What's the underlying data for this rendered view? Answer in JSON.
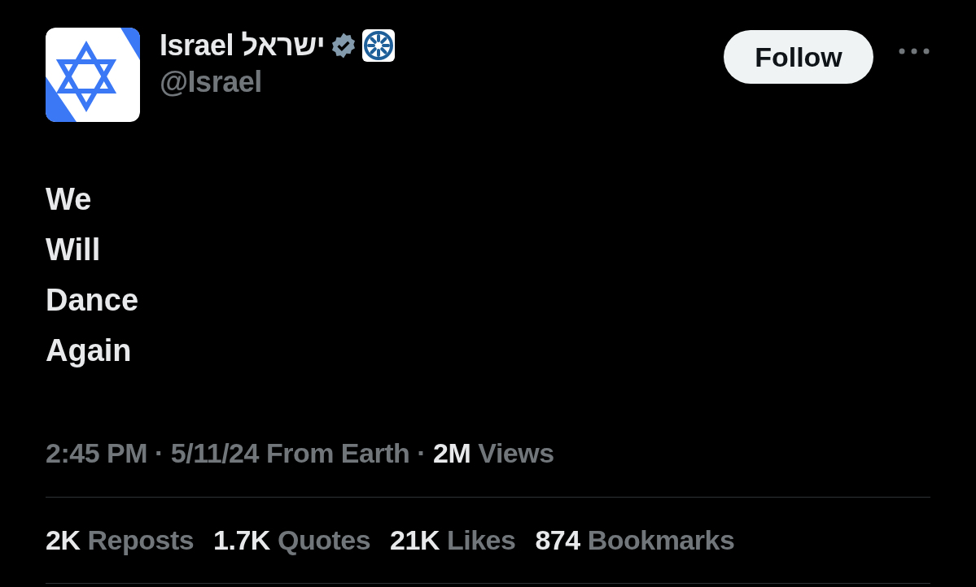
{
  "author": {
    "name": "Israel ישראל",
    "handle": "@Israel",
    "verified": true,
    "affiliate_badge": true,
    "follow_button": "Follow"
  },
  "text_lines": [
    "We",
    "Will",
    "Dance",
    "Again"
  ],
  "meta": {
    "time": "2:45 PM",
    "separator_1": "·",
    "date": "5/11/24",
    "source": "From Earth",
    "separator_2": "·",
    "views_count": "2M",
    "views_label": "Views"
  },
  "stats": [
    {
      "count": "2K",
      "label": "Reposts"
    },
    {
      "count": "1.7K",
      "label": "Quotes"
    },
    {
      "count": "21K",
      "label": "Likes"
    },
    {
      "count": "874",
      "label": "Bookmarks"
    }
  ]
}
